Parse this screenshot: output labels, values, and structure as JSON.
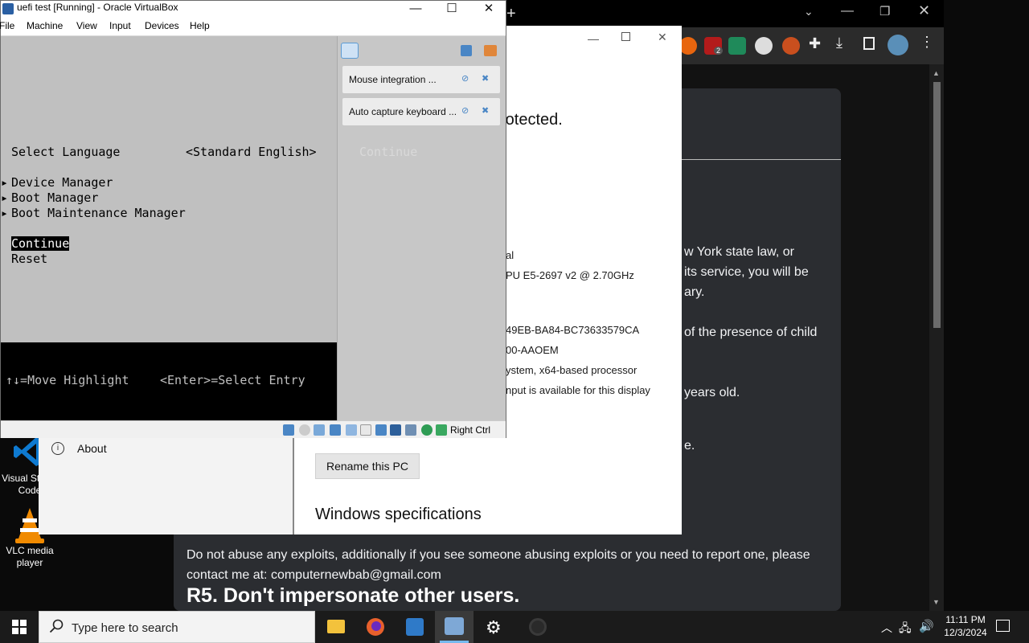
{
  "desktop": {
    "icons": [
      {
        "label": "Visual Studio Code"
      },
      {
        "label": "VLC media player"
      }
    ]
  },
  "chrome": {
    "discord": {
      "line1": "w York state law, or",
      "line2": "its service, you will be",
      "line3": "ary.",
      "line4": "of the presence of child",
      "line5": "years old.",
      "line6": "e.",
      "rule_text": "Do not abuse any exploits, additionally if you see someone abusing exploits or you need to report one, please contact me at: computernewbab@gmail.com",
      "rule_heading": "R5. Don't impersonate other users."
    },
    "ext_badge": "2"
  },
  "settings": {
    "about_label": "About",
    "protected_fragment": "rotected.",
    "specs": [
      "al",
      "PU E5-2697 v2 @ 2.70GHz",
      "49EB-BA84-BC73633579CA",
      "00-AAOEM",
      "ystem, x64-based processor",
      "nput is available for this display"
    ],
    "rename_button": "Rename this PC",
    "windows_spec_heading": "Windows specifications"
  },
  "vbox": {
    "title": "uefi test [Running] - Oracle VirtualBox",
    "menu": [
      "File",
      "Machine",
      "View",
      "Input",
      "Devices",
      "Help"
    ],
    "uefi": {
      "select_language": "Select Language",
      "language_value": "<Standard English>",
      "items": [
        "Device Manager",
        "Boot Manager",
        "Boot Maintenance Manager"
      ],
      "continue": "Continue",
      "reset": "Reset",
      "continue_ghost": "Continue",
      "help_move": "↑↓=Move Highlight",
      "help_enter": "<Enter>=Select Entry"
    },
    "notifications": [
      {
        "label": "Mouse integration ..."
      },
      {
        "label": "Auto capture keyboard ..."
      }
    ],
    "host_key": "Right Ctrl"
  },
  "taskbar": {
    "search_placeholder": "Type here to search",
    "time": "11:11 PM",
    "date": "12/3/2024"
  }
}
